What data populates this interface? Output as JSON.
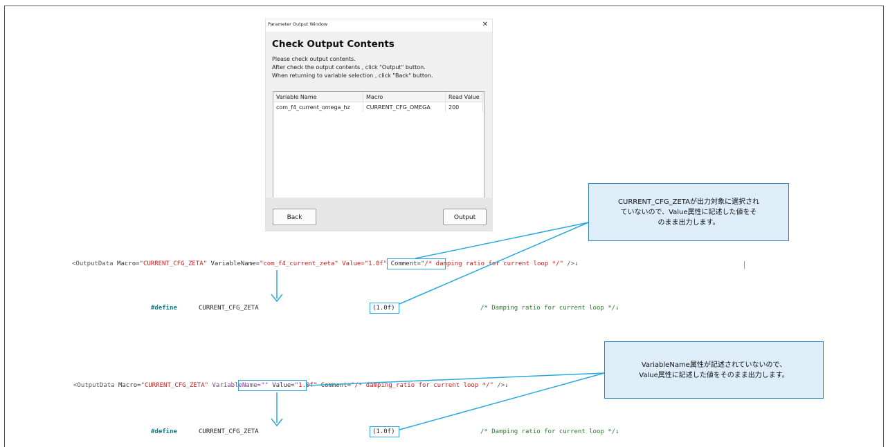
{
  "dialog": {
    "window_title": "Parameter Output Window",
    "close_glyph": "✕",
    "heading": "Check Output Contents",
    "instructions": [
      "Please check output contents.",
      "After check the output contents , click \"Output\" button.",
      "When returning to variable selection , click \"Back\" button."
    ],
    "columns": [
      "Variable Name",
      "Macro",
      "Read Value"
    ],
    "rows": [
      [
        "com_f4_current_omega_hz",
        "CURRENT_CFG_OMEGA",
        "200"
      ]
    ],
    "back_label": "Back",
    "output_label": "Output"
  },
  "example1": {
    "xml_open": "<OutputData ",
    "macro_attr": "Macro=",
    "macro_val": "\"CURRENT_CFG_ZETA\"",
    "varname_attr": " VariableName=",
    "varname_val": "\"com_f4_current_zeta\"",
    "value_full": "Value=\"1.0f\"",
    "comment_attr": " Comment=",
    "comment_val": "\"/* damping ratio for current loop */\"",
    "xml_close": " />↓",
    "define_kw": "#define",
    "define_name": "CURRENT_CFG_ZETA",
    "define_value": "(1.0f)",
    "define_comment": "/* Damping ratio for current loop */↓"
  },
  "example2": {
    "xml_open": "<OutputData ",
    "macro_attr": "Macro=",
    "macro_val": "\"CURRENT_CFG_ZETA\"",
    "varname_full": "VariableName=\"\"",
    "value_attr": " Value=",
    "value_val": "\"1.0f\"",
    "comment_attr": " Comment=",
    "comment_val": "\"/* damping_ratio for current loop */\"",
    "xml_close": " />↓",
    "define_kw": "#define",
    "define_name": "CURRENT_CFG_ZETA",
    "define_value": "(1.0f)",
    "define_comment": "/* Damping ratio for current loop */↓"
  },
  "callout1": {
    "lines": [
      "CURRENT_CFG_ZETAが出力対象に選択され",
      "ていないので、Value属性に記述した値をそ",
      "のまま出力します。"
    ]
  },
  "callout2": {
    "lines": [
      "VariableName属性が記述されていないので、",
      "Value属性に記述した値をそのまま出力します。"
    ]
  },
  "colors": {
    "highlight": "#29a8e0",
    "callout_bg": "#ddeef9",
    "callout_border": "#2a7fc0"
  }
}
